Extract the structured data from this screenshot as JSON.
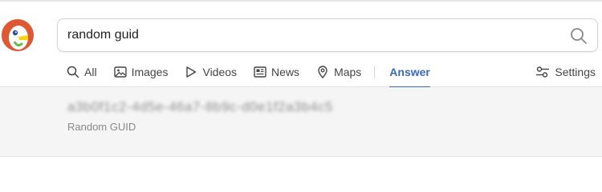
{
  "search": {
    "query": "random guid"
  },
  "tabs": [
    {
      "label": "All",
      "icon": "search-icon"
    },
    {
      "label": "Images",
      "icon": "image-icon"
    },
    {
      "label": "Videos",
      "icon": "play-icon"
    },
    {
      "label": "News",
      "icon": "newspaper-icon"
    },
    {
      "label": "Maps",
      "icon": "map-pin-icon"
    },
    {
      "label": "Answer",
      "active": true
    }
  ],
  "settings": {
    "label": "Settings",
    "icon": "sliders-icon"
  },
  "answer": {
    "value": "a3b0f1c2-4d5e-46a7-8b9c-d0e1f2a3b4c5",
    "label": "Random GUID"
  },
  "colors": {
    "accent": "#3969bf",
    "brand": "#de5833",
    "answer_bg": "#f5f5f5"
  }
}
